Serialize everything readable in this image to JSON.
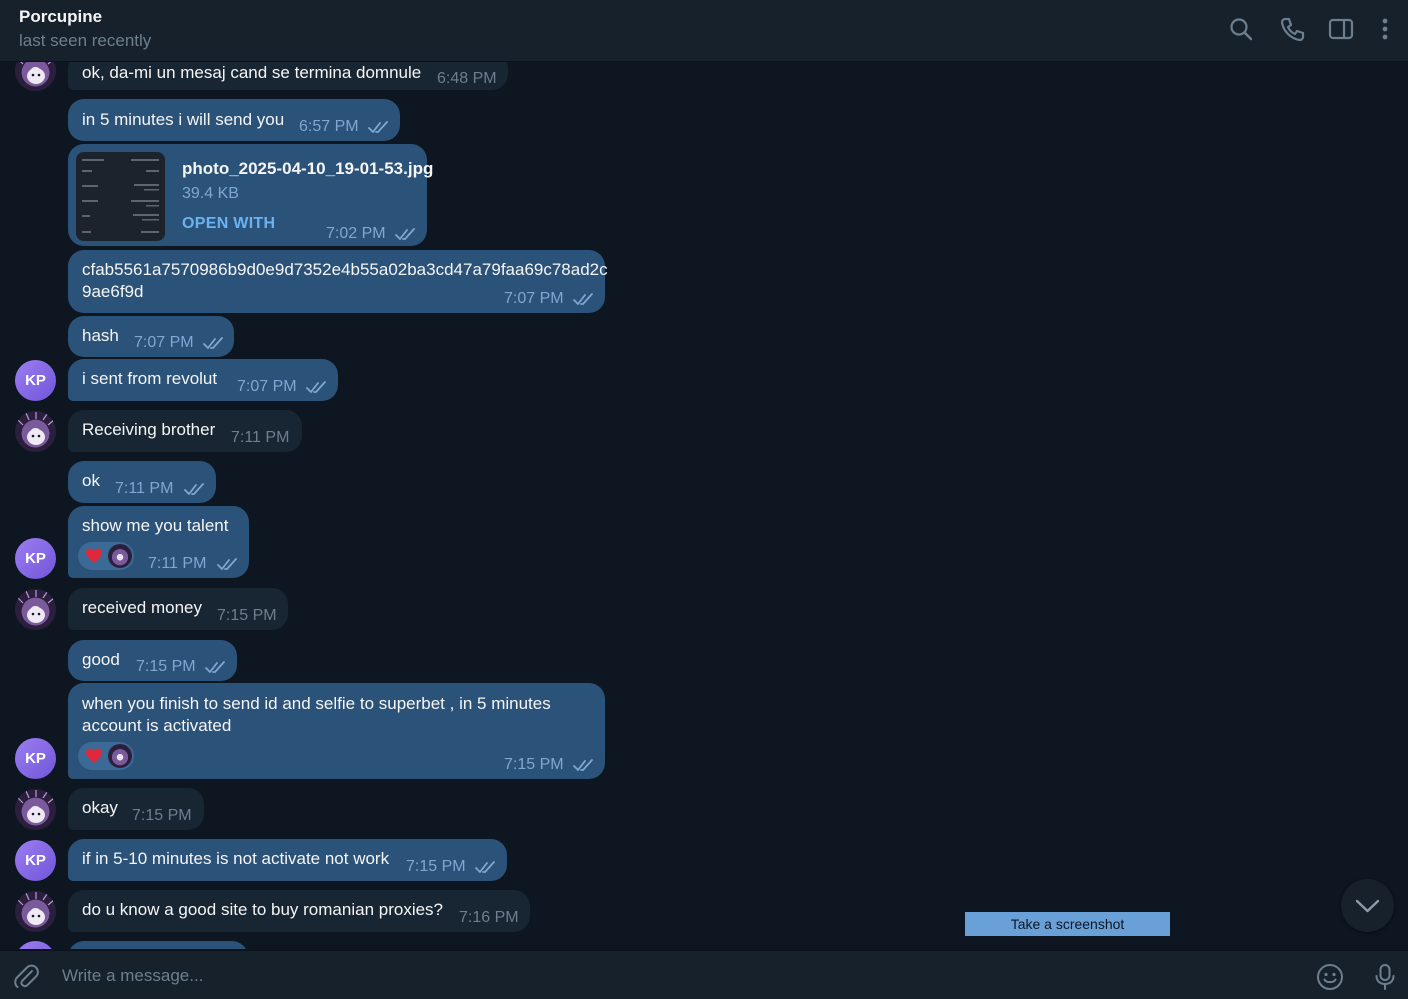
{
  "header": {
    "name": "Porcupine",
    "status": "last seen recently",
    "icons": [
      "search-icon",
      "phone-icon",
      "sidebar-toggle-icon",
      "more-vertical-icon"
    ]
  },
  "messages": [
    {
      "id": "m1",
      "direction": "in",
      "text": "ok, da-mi un mesaj cand se termina domnule",
      "time": "6:48 PM"
    },
    {
      "id": "m2",
      "direction": "out",
      "text": "in 5 minutes i will send you",
      "time": "6:57 PM",
      "read": true
    },
    {
      "id": "m3",
      "direction": "out",
      "type": "file",
      "file_name": "photo_2025-04-10_19-01-53.jpg",
      "file_size": "39.4 KB",
      "action": "OPEN WITH",
      "time": "7:02 PM",
      "read": true
    },
    {
      "id": "m4",
      "direction": "out",
      "text_line1": "cfab5561a7570986b9d0e9d7352e4b55a02ba3cd47a79faa69c78ad2c",
      "text_line2": "9ae6f9d",
      "time": "7:07 PM",
      "read": true
    },
    {
      "id": "m5",
      "direction": "out",
      "text": "hash",
      "time": "7:07 PM",
      "read": true
    },
    {
      "id": "m6",
      "direction": "out",
      "text": "i sent from revolut",
      "time": "7:07 PM",
      "read": true,
      "avatar": "KP"
    },
    {
      "id": "m7",
      "direction": "in",
      "text": "Receiving brother",
      "time": "7:11 PM"
    },
    {
      "id": "m8",
      "direction": "out",
      "text": "ok",
      "time": "7:11 PM",
      "read": true
    },
    {
      "id": "m9",
      "direction": "out",
      "text": "show me you talent",
      "time": "7:11 PM",
      "read": true,
      "reaction": "heart",
      "avatar": "KP"
    },
    {
      "id": "m10",
      "direction": "in",
      "text": "received money",
      "time": "7:15 PM"
    },
    {
      "id": "m11",
      "direction": "out",
      "text": "good",
      "time": "7:15 PM",
      "read": true
    },
    {
      "id": "m12",
      "direction": "out",
      "text_line1": "when you finish to send id and selfie to superbet , in 5 minutes",
      "text_line2": "account is activated",
      "time": "7:15 PM",
      "read": true,
      "reaction": "heart",
      "avatar": "KP"
    },
    {
      "id": "m13",
      "direction": "in",
      "text": "okay",
      "time": "7:15 PM"
    },
    {
      "id": "m14",
      "direction": "out",
      "text": "if in 5-10 minutes is not activate not work",
      "time": "7:15 PM",
      "read": true,
      "avatar": "KP"
    },
    {
      "id": "m15",
      "direction": "in",
      "text": "do u know a good site to buy romanian proxies?",
      "time": "7:16 PM"
    }
  ],
  "overlay": {
    "screenshot_label": "Take a screenshot"
  },
  "composer": {
    "placeholder": "Write a message...",
    "icons": [
      "attach-icon",
      "emoji-icon",
      "microphone-icon"
    ]
  },
  "colors": {
    "background": "#0e1621",
    "header": "#17212b",
    "outgoing_bubble": "#2b5278",
    "incoming_bubble": "#182533",
    "accent": "#6ab3f3",
    "avatar_kp": "#8b6cf0"
  }
}
